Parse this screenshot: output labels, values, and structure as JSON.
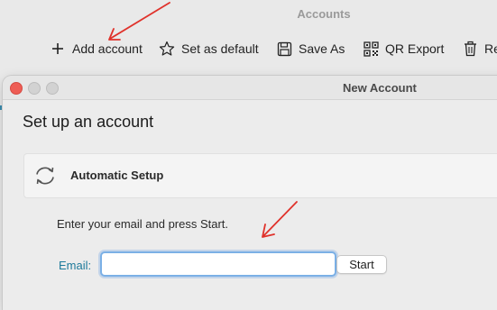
{
  "accounts_window": {
    "title": "Accounts",
    "toolbar": {
      "add_account": {
        "label": "Add account",
        "icon": "plus-icon"
      },
      "set_default": {
        "label": "Set as default",
        "icon": "star-icon"
      },
      "save_as": {
        "label": "Save As",
        "icon": "floppy-disk-icon"
      },
      "qr_export": {
        "label": "QR Export",
        "icon": "qr-code-icon"
      },
      "remove": {
        "label": "Re",
        "icon": "trash-icon"
      }
    }
  },
  "new_account_dialog": {
    "title": "New Account",
    "heading": "Set up an account",
    "automatic_setup": {
      "label": "Automatic Setup",
      "icon": "sync-arrows-icon"
    },
    "instruction": "Enter your email and press Start.",
    "email": {
      "label": "Email:",
      "value": "",
      "placeholder": ""
    },
    "start_label": "Start"
  },
  "colors": {
    "annotation_arrow": "#e0322b",
    "email_label": "#1d7a9b",
    "focus_ring": "#7bb0e6",
    "close_button": "#ee5d55"
  }
}
